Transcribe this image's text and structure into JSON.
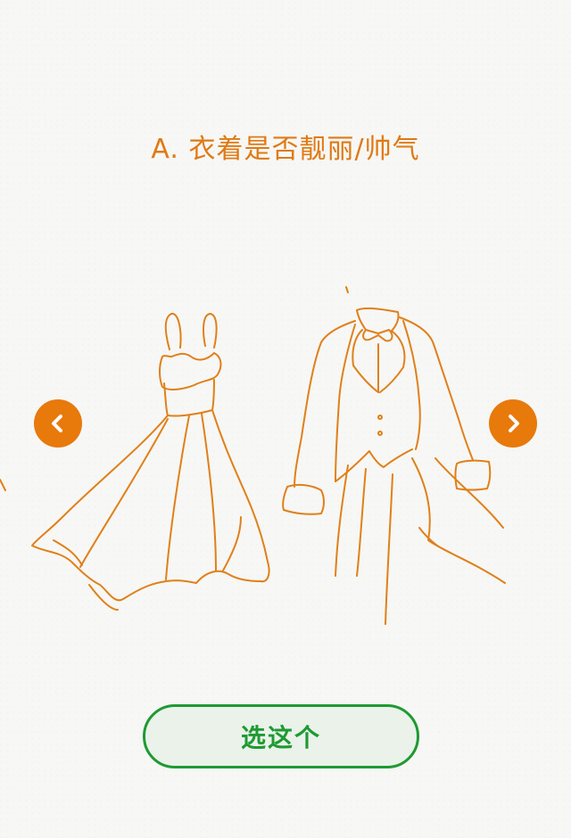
{
  "question": {
    "title": "A. 衣着是否靓丽/帅气"
  },
  "illustration": {
    "description_icon": "dress-and-tuxedo-sketch"
  },
  "navigation": {
    "prev_icon": "chevron-left-icon",
    "next_icon": "chevron-right-icon"
  },
  "action": {
    "choose_label": "选这个"
  },
  "colors": {
    "accent_orange": "#e8790b",
    "title_orange": "#e07a14",
    "button_green": "#1e9a32",
    "button_bg": "#eaf2ea",
    "background": "#f7f7f5"
  }
}
